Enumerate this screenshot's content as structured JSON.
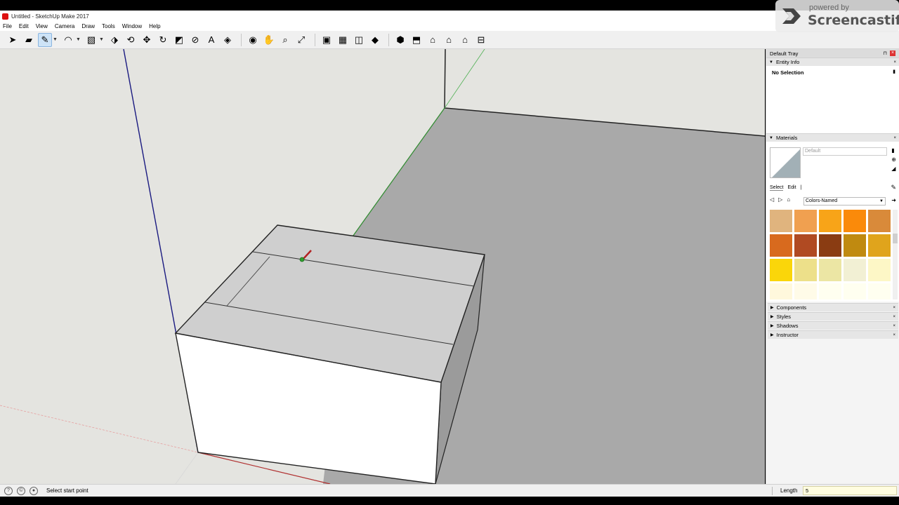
{
  "window": {
    "title": "Untitled - SketchUp Make 2017"
  },
  "menu": [
    "File",
    "Edit",
    "View",
    "Camera",
    "Draw",
    "Tools",
    "Window",
    "Help"
  ],
  "toolbar": {
    "tools": [
      {
        "name": "select-tool",
        "icon": "arrow-icon",
        "glyph": "➤"
      },
      {
        "name": "eraser-tool",
        "icon": "eraser-icon",
        "glyph": "▰"
      },
      {
        "name": "line-tool",
        "icon": "pencil-icon",
        "glyph": "✎",
        "active": true
      },
      {
        "name": "arc-tool",
        "icon": "arc-icon",
        "glyph": "◠"
      },
      {
        "name": "shape-tool",
        "icon": "rectangle-icon",
        "glyph": "▧"
      },
      {
        "name": "push-pull-tool",
        "icon": "push-pull-icon",
        "glyph": "⬗"
      },
      {
        "name": "offset-tool",
        "icon": "offset-icon",
        "glyph": "⟲"
      },
      {
        "name": "move-tool",
        "icon": "move-icon",
        "glyph": "✥"
      },
      {
        "name": "rotate-tool",
        "icon": "rotate-icon",
        "glyph": "↻"
      },
      {
        "name": "scale-tool",
        "icon": "scale-icon",
        "glyph": "◩"
      },
      {
        "name": "tape-measure-tool",
        "icon": "tape-measure-icon",
        "glyph": "⊘"
      },
      {
        "name": "text-tool",
        "icon": "text-icon",
        "glyph": "A"
      },
      {
        "name": "paint-bucket-tool",
        "icon": "paint-bucket-icon",
        "glyph": "◈"
      },
      {
        "name": "orbit-tool",
        "icon": "orbit-icon",
        "glyph": "◉"
      },
      {
        "name": "pan-tool",
        "icon": "pan-icon",
        "glyph": "✋"
      },
      {
        "name": "zoom-tool",
        "icon": "zoom-icon",
        "glyph": "⌕"
      },
      {
        "name": "zoom-extents-tool",
        "icon": "zoom-extents-icon",
        "glyph": "⤢"
      },
      {
        "name": "warehouse-tool",
        "icon": "warehouse-icon",
        "glyph": "▣"
      },
      {
        "name": "extension-warehouse-tool",
        "icon": "extension-icon",
        "glyph": "▦"
      },
      {
        "name": "share-model-tool",
        "icon": "share-icon",
        "glyph": "◫"
      },
      {
        "name": "ruby-tool",
        "icon": "ruby-icon",
        "glyph": "◆"
      },
      {
        "name": "iso-view",
        "icon": "iso-view-icon",
        "glyph": "⬢"
      },
      {
        "name": "top-view",
        "icon": "top-view-icon",
        "glyph": "⬒"
      },
      {
        "name": "front-view",
        "icon": "front-view-icon",
        "glyph": "⌂"
      },
      {
        "name": "right-view",
        "icon": "right-view-icon",
        "glyph": "⌂"
      },
      {
        "name": "back-view",
        "icon": "back-view-icon",
        "glyph": "⌂"
      },
      {
        "name": "left-view",
        "icon": "left-view-icon",
        "glyph": "⊟"
      }
    ]
  },
  "tray": {
    "title": "Default Tray",
    "entity_info": {
      "title": "Entity Info",
      "selection": "No Selection"
    },
    "materials": {
      "title": "Materials",
      "name_placeholder": "Default",
      "tab_select": "Select",
      "tab_edit": "Edit",
      "library": "Colors-Named",
      "swatches": [
        "#e0b47e",
        "#f0a050",
        "#f8a418",
        "#fa8a0a",
        "#d98a3a",
        "#d86a1e",
        "#b04a22",
        "#8a3c12",
        "#c08a10",
        "#e0a41c",
        "#fad60a",
        "#ede08a",
        "#ece6a4",
        "#f2f0d4",
        "#fdf7c6",
        "#fff8dc",
        "#fffbe8",
        "#fffff0",
        "#fffff0",
        "#fffff0"
      ]
    },
    "collapsed_panels": [
      "Components",
      "Styles",
      "Shadows",
      "Instructor"
    ]
  },
  "status": {
    "message": "Select start point",
    "measure_label": "Length",
    "measure_value": "5"
  },
  "watermark": {
    "small": "powered by",
    "big": "Screencastify"
  }
}
